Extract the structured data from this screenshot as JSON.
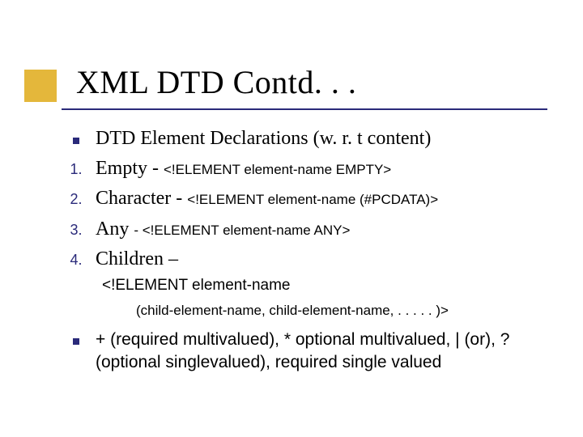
{
  "title": "XML DTD Contd. . .",
  "items": {
    "intro": "DTD Element Declarations (w. r. t content)",
    "n1": {
      "num": "1.",
      "lead": "Empty - ",
      "code": "<!ELEMENT element-name EMPTY>"
    },
    "n2": {
      "num": "2.",
      "lead": "Character - ",
      "code": "<!ELEMENT element-name (#PCDATA)>"
    },
    "n3": {
      "num": "3.",
      "lead": "Any ",
      "dash": "-  ",
      "code": "<!ELEMENT element-name ANY>"
    },
    "n4": {
      "num": "4.",
      "lead": "Children –"
    }
  },
  "sub1": "<!ELEMENT element-name",
  "sub2": "(child-element-name, child-element-name, . . . . . )>",
  "tail": "+ (required multivalued), * optional multivalued, | (or), ? (optional singlevalued), required single valued"
}
